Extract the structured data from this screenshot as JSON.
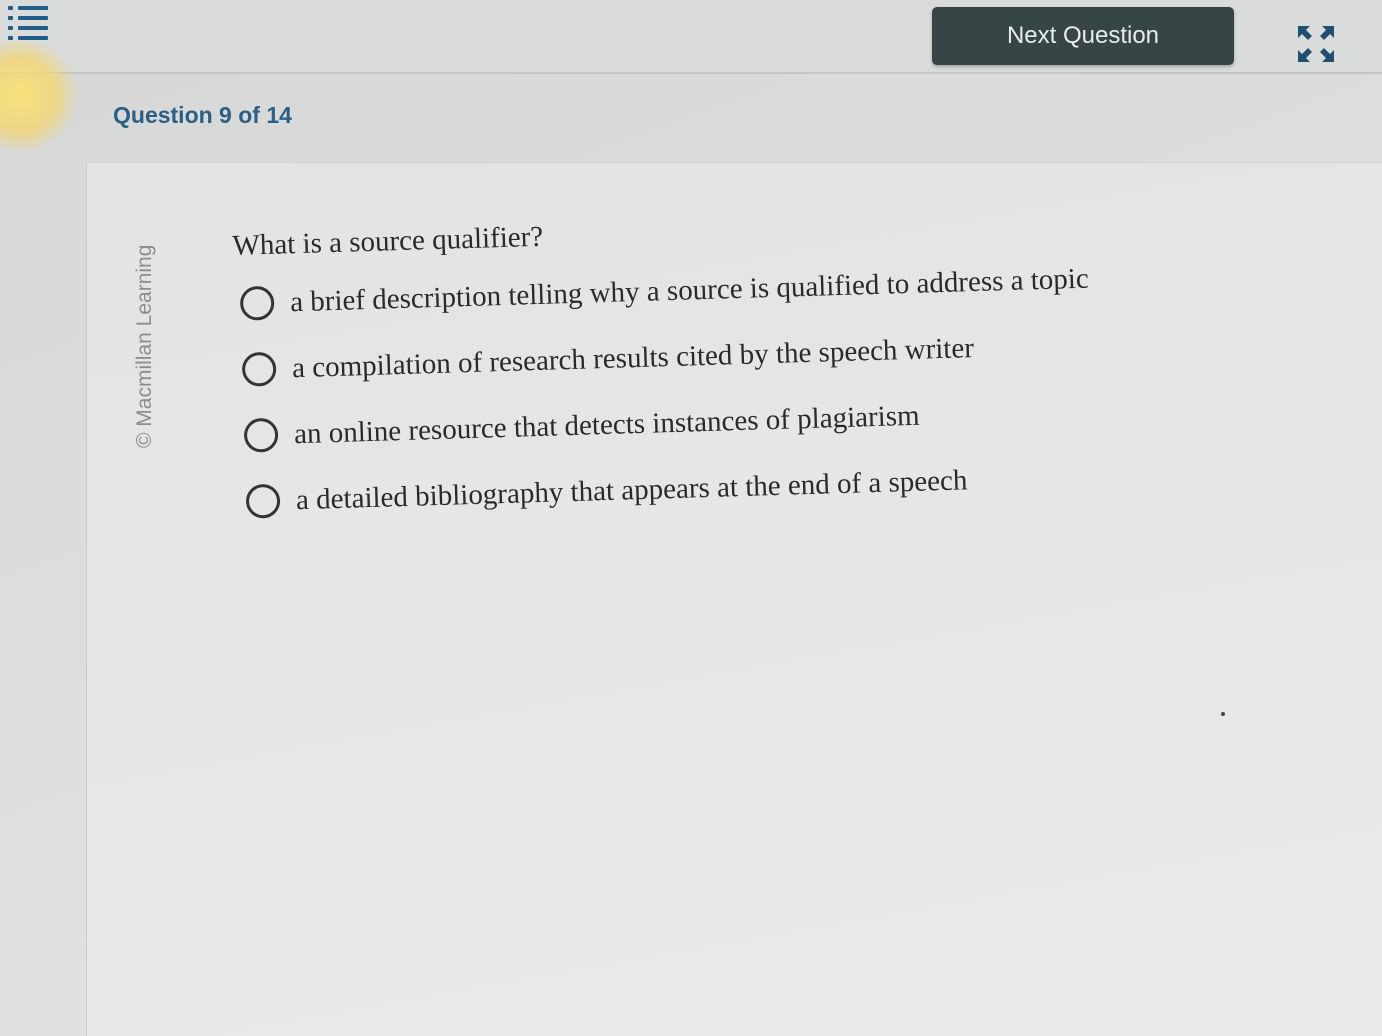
{
  "header": {
    "next_button_label": "Next Question"
  },
  "question": {
    "counter": "Question 9 of 14",
    "copyright": "© Macmillan Learning",
    "prompt": "What is a source qualifier?",
    "options": [
      {
        "label": "a brief description telling why a source is qualified to address a topic"
      },
      {
        "label": "a compilation of research results cited by the speech writer"
      },
      {
        "label": "an online resource that detects instances of plagiarism"
      },
      {
        "label": "a detailed bibliography that appears at the end of a speech"
      }
    ]
  },
  "icons": {
    "menu": "list-menu-icon",
    "expand": "expand-arrows-icon"
  },
  "colors": {
    "accent": "#2b5f86",
    "button_bg": "#374545"
  }
}
